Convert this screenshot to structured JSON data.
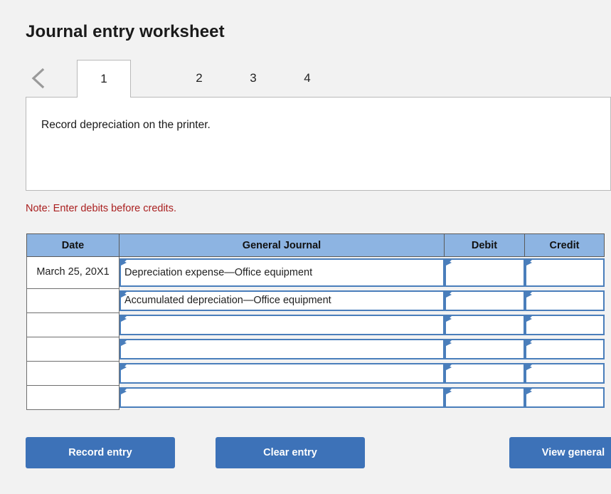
{
  "header": {
    "title": "Journal entry worksheet"
  },
  "tabs": {
    "prev_icon": "chevron-left-icon",
    "items": [
      {
        "label": "1",
        "active": true
      },
      {
        "label": "2",
        "active": false
      },
      {
        "label": "3",
        "active": false
      },
      {
        "label": "4",
        "active": false
      }
    ]
  },
  "question": {
    "text": "Record depreciation on the printer."
  },
  "note": {
    "text": "Note: Enter debits before credits."
  },
  "table": {
    "columns": [
      "Date",
      "General Journal",
      "Debit",
      "Credit"
    ],
    "rows": [
      {
        "date": "March 25, 20X1",
        "account": "Depreciation expense—Office equipment",
        "debit": "",
        "credit": ""
      },
      {
        "date": "",
        "account": "Accumulated depreciation—Office equipment",
        "debit": "",
        "credit": ""
      },
      {
        "date": "",
        "account": "",
        "debit": "",
        "credit": ""
      },
      {
        "date": "",
        "account": "",
        "debit": "",
        "credit": ""
      },
      {
        "date": "",
        "account": "",
        "debit": "",
        "credit": ""
      },
      {
        "date": "",
        "account": "",
        "debit": "",
        "credit": ""
      }
    ]
  },
  "buttons": {
    "record": "Record entry",
    "clear": "Clear entry",
    "view": "View general"
  },
  "colors": {
    "page_background": "#f2f2f2",
    "header_fill": "#8db4e2",
    "input_border": "#4a7ebb",
    "button_fill": "#3d72b8",
    "note_text": "#aa2020"
  }
}
